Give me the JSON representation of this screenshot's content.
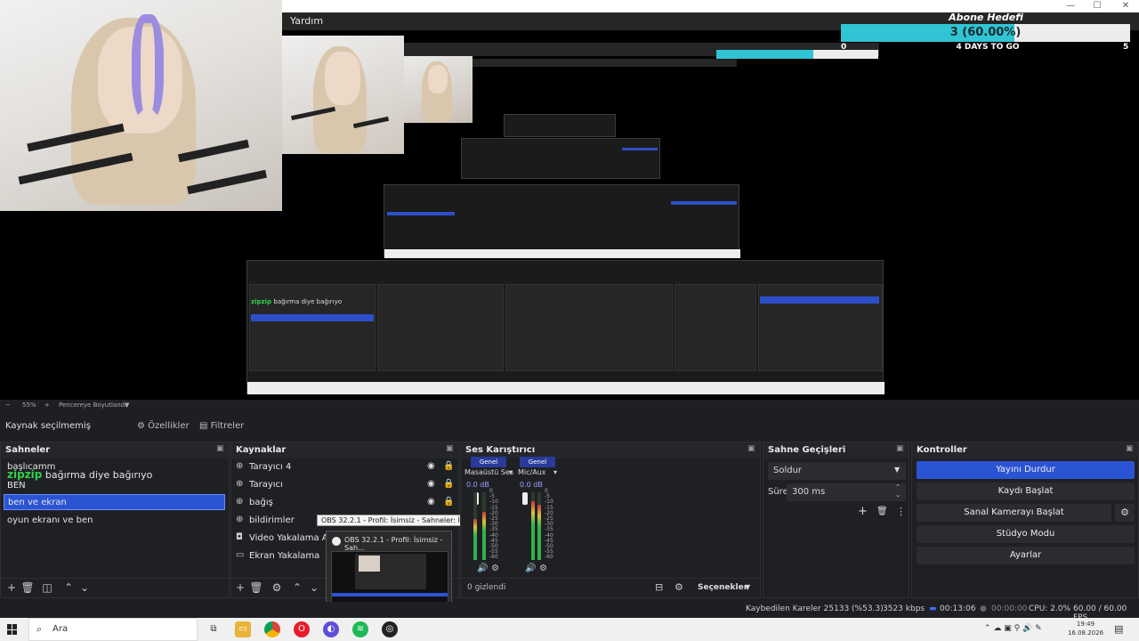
{
  "window": {
    "menu_label": "Yardım",
    "minimize": "—",
    "maximize": "☐",
    "close": "✕"
  },
  "goal": {
    "title": "Abone Hedefi",
    "value_text": "3 (60.00%)",
    "progress_fraction": 0.6,
    "min_label": "0",
    "days_text": "4 DAYS TO GO",
    "max_label": "5",
    "fill_color": "#30c4d4"
  },
  "preview": {
    "zoom_text": "55%",
    "fit_text": "Pencereye Boyutlandır"
  },
  "properties_bar": {
    "source_label": "Kaynak seçilmemiş",
    "properties_button": "Özellikler",
    "filters_button": "Filtreler"
  },
  "scenes": {
    "title": "Sahneler",
    "items": [
      {
        "label": "başlıcamm"
      },
      {
        "label": "zipzip bağırma diye bağırıyo",
        "highlight": "zipzip",
        "rest": "bağırma diye bağırıyo"
      },
      {
        "label": "BEN"
      },
      {
        "label": "ben ve ekran",
        "selected": true
      },
      {
        "label": "oyun ekranı ve ben"
      }
    ]
  },
  "sources": {
    "title": "Kaynaklar",
    "items": [
      {
        "label": "Tarayıcı 4",
        "icon": "globe-icon"
      },
      {
        "label": "Tarayıcı",
        "icon": "globe-icon"
      },
      {
        "label": "bağış",
        "icon": "globe-icon"
      },
      {
        "label": "bildirimler",
        "icon": "globe-icon"
      },
      {
        "label": "Video Yakalama Aygıtı",
        "icon": "camera-icon"
      },
      {
        "label": "Ekran Yakalama",
        "icon": "monitor-icon"
      }
    ],
    "tooltip_small": "OBS 32.2.1 - Profil: İsimsiz - Sahneler: İsimsiz",
    "thumb_title": "OBS 32.2.1 - Profil: İsimsiz - Sah..."
  },
  "mixer": {
    "title": "Ses Karıştırıcı",
    "channels": [
      {
        "tab": "Genel",
        "name": "Masaüstü Ses",
        "db": "0.0 dB"
      },
      {
        "tab": "Genel",
        "name": "Mic/Aux",
        "db": "0.0 dB"
      }
    ],
    "scale": [
      "0",
      "-5",
      "-10",
      "-15",
      "-20",
      "-25",
      "-30",
      "-35",
      "-40",
      "-45",
      "-50",
      "-55",
      "-60"
    ],
    "hidden_text": "0 gizlendi",
    "advanced_label": "Seçenekler"
  },
  "transitions": {
    "title": "Sahne Geçişleri",
    "transition": "Soldur",
    "duration_label": "Süre",
    "duration_value": "300 ms"
  },
  "controls": {
    "title": "Kontroller",
    "buttons": [
      {
        "label": "Yayını Durdur",
        "primary": true
      },
      {
        "label": "Kaydı Başlat"
      },
      {
        "label": "Sanal Kamerayı Başlat"
      },
      {
        "label": "Stüdyo Modu"
      },
      {
        "label": "Ayarlar"
      }
    ]
  },
  "status": {
    "dropped": "Kaybedilen Kareler 25133 (%53.3)",
    "bitrate": "3523 kbps",
    "stream_time": "00:13:06",
    "rec_time": "00:00:00",
    "cpu": "CPU: 2.0%",
    "fps": "60.00 / 60.00 FPS"
  },
  "taskbar": {
    "search_placeholder": "Ara",
    "time": "19:49",
    "date": "16.08.2026"
  },
  "colors": {
    "accent": "#2b54d4",
    "bg": "#1f2024",
    "goal_fill": "#30c4d4"
  }
}
